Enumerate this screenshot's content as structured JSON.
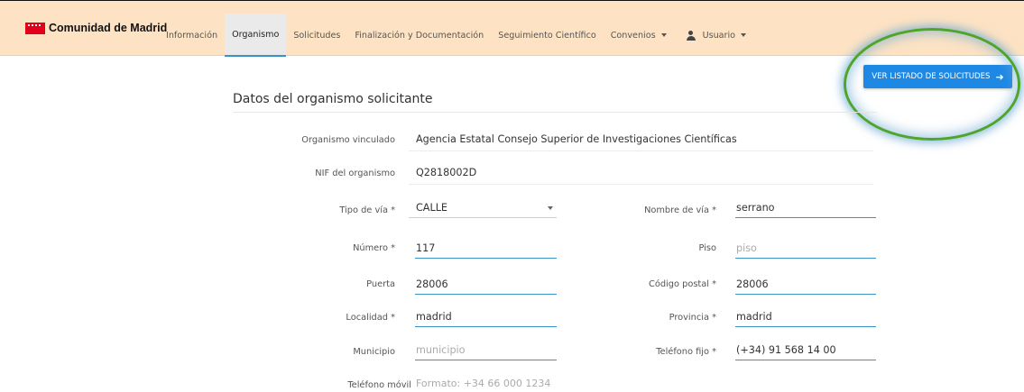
{
  "header": {
    "brand": "Comunidad de Madrid",
    "brand_color": "#e2001a",
    "nav": [
      {
        "label": "Información",
        "active": false
      },
      {
        "label": "Organismo",
        "active": true
      },
      {
        "label": "Solicitudes",
        "active": false
      },
      {
        "label": "Finalización y Documentación",
        "active": false
      },
      {
        "label": "Seguimiento Científico",
        "active": false
      },
      {
        "label": "Convenios",
        "active": false,
        "dropdown": true
      },
      {
        "label": "Usuario",
        "active": false,
        "dropdown": true,
        "icon": "user-icon"
      }
    ]
  },
  "actions": {
    "list_button": "VER LISTADO DE SOLICITUDES",
    "list_button_icon": "arrow-right-icon",
    "accent": "#1e88e5"
  },
  "form": {
    "title": "Datos del organismo solicitante",
    "organismo": {
      "label": "Organismo vinculado",
      "value": "Agencia Estatal Consejo Superior de Investigaciones Científicas"
    },
    "nif": {
      "label": "NIF del organismo",
      "value": "Q2818002D"
    },
    "tipo_via": {
      "label": "Tipo de vía *",
      "value": "CALLE"
    },
    "nombre_via": {
      "label": "Nombre de vía *",
      "value": "serrano"
    },
    "numero": {
      "label": "Número *",
      "value": "117"
    },
    "piso": {
      "label": "Piso",
      "value": "",
      "placeholder": "piso"
    },
    "puerta": {
      "label": "Puerta",
      "value": "28006"
    },
    "codigo_postal": {
      "label": "Código postal *",
      "value": "28006"
    },
    "localidad": {
      "label": "Localidad *",
      "value": "madrid"
    },
    "provincia": {
      "label": "Provincia *",
      "value": "madrid"
    },
    "municipio": {
      "label": "Municipio",
      "value": "",
      "placeholder": "municipio"
    },
    "telefono_fijo": {
      "label": "Teléfono fijo *",
      "value": "(+34) 91 568 14 00"
    },
    "telefono_movil": {
      "label": "Teléfono móvil",
      "value": "",
      "placeholder": "Formato: +34 66 000 1234"
    }
  }
}
